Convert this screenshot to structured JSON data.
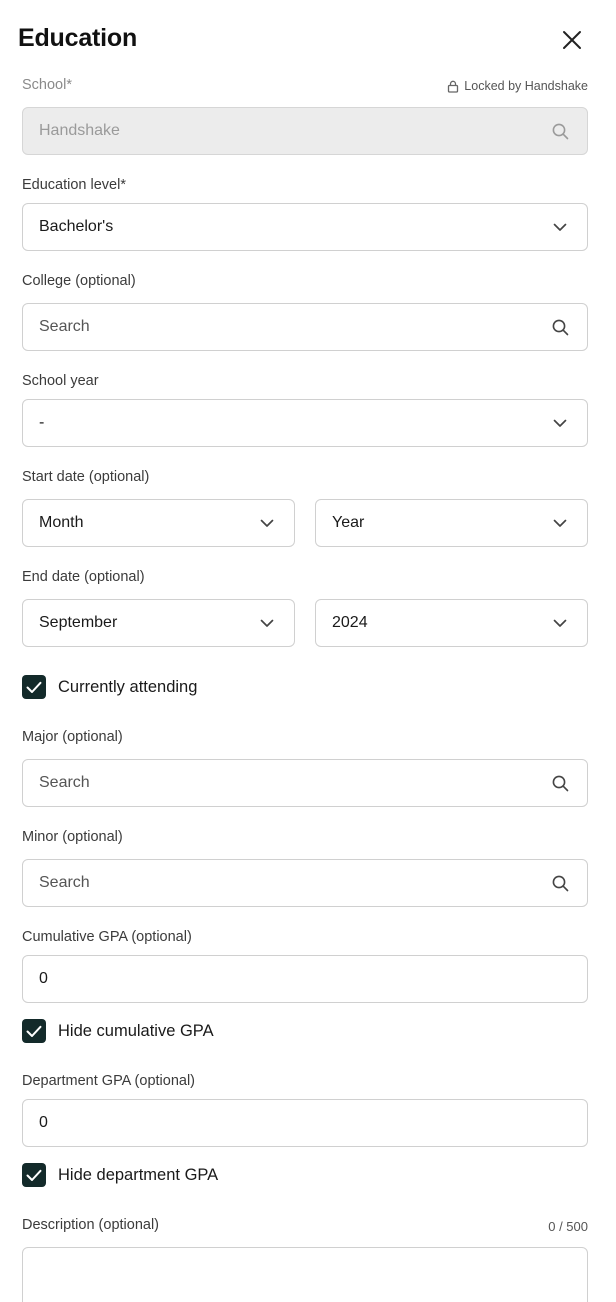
{
  "header": {
    "title": "Education"
  },
  "school": {
    "label": "School*",
    "locked_text": "Locked by Handshake",
    "value": "Handshake"
  },
  "education_level": {
    "label": "Education level*",
    "value": "Bachelor's"
  },
  "college": {
    "label": "College (optional)",
    "placeholder": "Search"
  },
  "school_year": {
    "label": "School year",
    "value": "-"
  },
  "start_date": {
    "label": "Start date (optional)",
    "month": "Month",
    "year": "Year"
  },
  "end_date": {
    "label": "End date (optional)",
    "month": "September",
    "year": "2024"
  },
  "currently_attending": {
    "label": "Currently attending",
    "checked": true
  },
  "major": {
    "label": "Major (optional)",
    "placeholder": "Search"
  },
  "minor": {
    "label": "Minor (optional)",
    "placeholder": "Search"
  },
  "cumulative_gpa": {
    "label": "Cumulative GPA (optional)",
    "value": "0"
  },
  "hide_cumulative_gpa": {
    "label": "Hide cumulative GPA",
    "checked": true
  },
  "department_gpa": {
    "label": "Department GPA (optional)",
    "value": "0"
  },
  "hide_department_gpa": {
    "label": "Hide department GPA",
    "checked": true
  },
  "description": {
    "label": "Description (optional)",
    "counter": "0 / 500"
  },
  "icons": {
    "close": "close-icon",
    "lock": "lock-icon",
    "search": "search-icon",
    "dropdown": "chevron-down-icon",
    "check": "check-icon"
  },
  "colors": {
    "checkbox_fill": "#132a2a",
    "border": "#d0d0d0",
    "disabled_bg": "#ececec"
  }
}
